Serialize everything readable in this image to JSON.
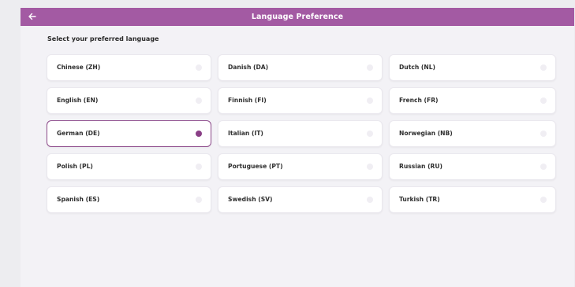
{
  "header": {
    "title": "Language Preference",
    "back_icon": "arrow-left-icon",
    "color": "#a35aa3"
  },
  "instruction": "Select your preferred language",
  "selected_language": "German (DE)",
  "languages": [
    {
      "label": "Chinese (ZH)",
      "selected": false
    },
    {
      "label": "Danish (DA)",
      "selected": false
    },
    {
      "label": "Dutch (NL)",
      "selected": false
    },
    {
      "label": "English (EN)",
      "selected": false
    },
    {
      "label": "Finnish (FI)",
      "selected": false
    },
    {
      "label": "French (FR)",
      "selected": false
    },
    {
      "label": "German (DE)",
      "selected": true
    },
    {
      "label": "Italian (IT)",
      "selected": false
    },
    {
      "label": "Norwegian (NB)",
      "selected": false
    },
    {
      "label": "Polish (PL)",
      "selected": false
    },
    {
      "label": "Portuguese (PT)",
      "selected": false
    },
    {
      "label": "Russian (RU)",
      "selected": false
    },
    {
      "label": "Spanish (ES)",
      "selected": false
    },
    {
      "label": "Swedish (SV)",
      "selected": false
    },
    {
      "label": "Turkish (TR)",
      "selected": false
    }
  ],
  "colors": {
    "accent": "#8a3f86",
    "background": "#f3f2f6"
  }
}
